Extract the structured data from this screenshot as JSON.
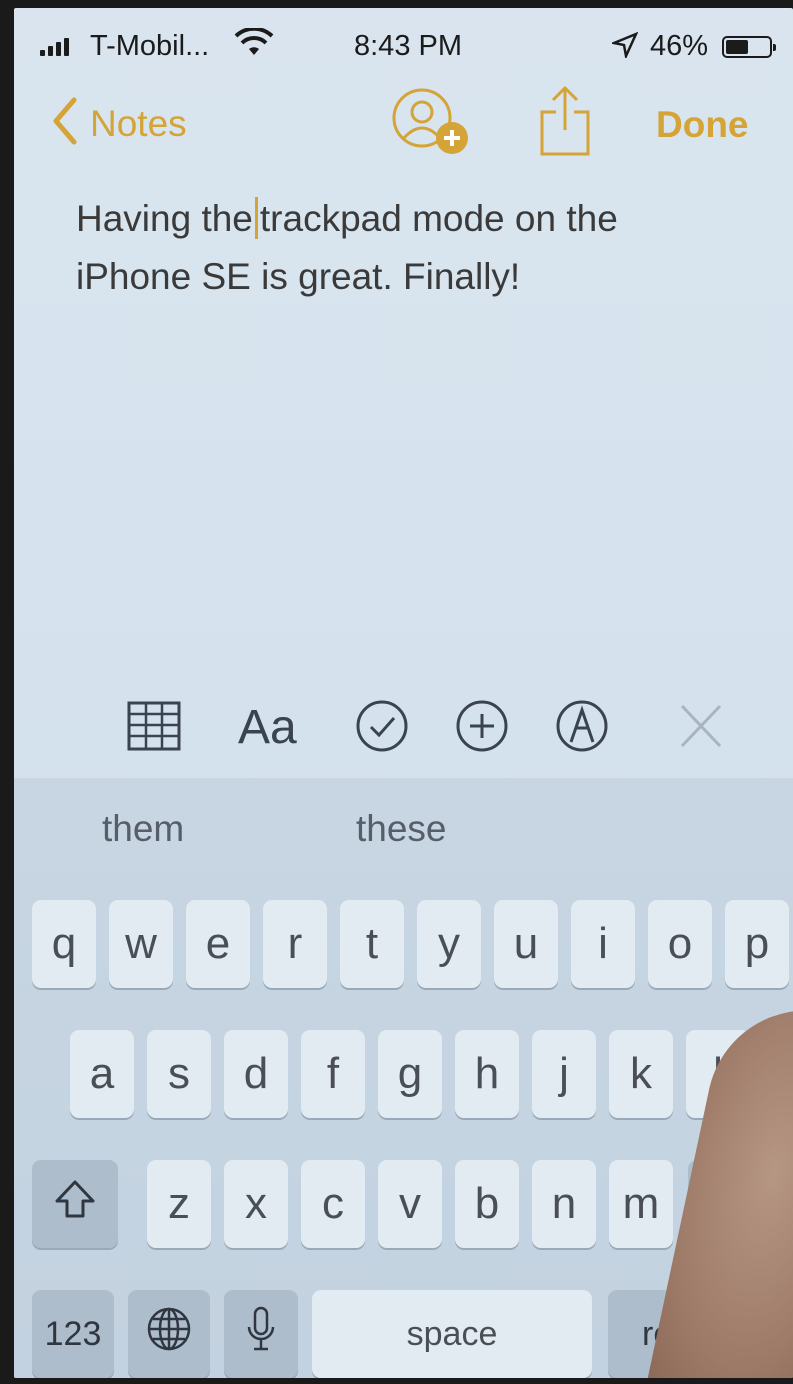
{
  "status_bar": {
    "carrier": "T-Mobil...",
    "time": "8:43 PM",
    "battery": "46%"
  },
  "nav": {
    "back_label": "Notes",
    "done_label": "Done"
  },
  "note": {
    "text_before_cursor": "Having the",
    "text_after_cursor": "trackpad mode on the iPhone SE is great. Finally!"
  },
  "toolbar": {
    "format_label": "Aa"
  },
  "keyboard": {
    "suggestions": [
      "them",
      "these"
    ],
    "row1": [
      "q",
      "w",
      "e",
      "r",
      "t",
      "y",
      "u",
      "i",
      "o",
      "p"
    ],
    "row2": [
      "a",
      "s",
      "d",
      "f",
      "g",
      "h",
      "j",
      "k",
      "l"
    ],
    "row3": [
      "z",
      "x",
      "c",
      "v",
      "b",
      "n",
      "m"
    ],
    "numbers_label": "123",
    "space_label": "space",
    "return_label": "retu"
  },
  "colors": {
    "accent": "#d4a437",
    "background": "#d8e4ee",
    "keyboard_bg": "#c6d4e1"
  }
}
